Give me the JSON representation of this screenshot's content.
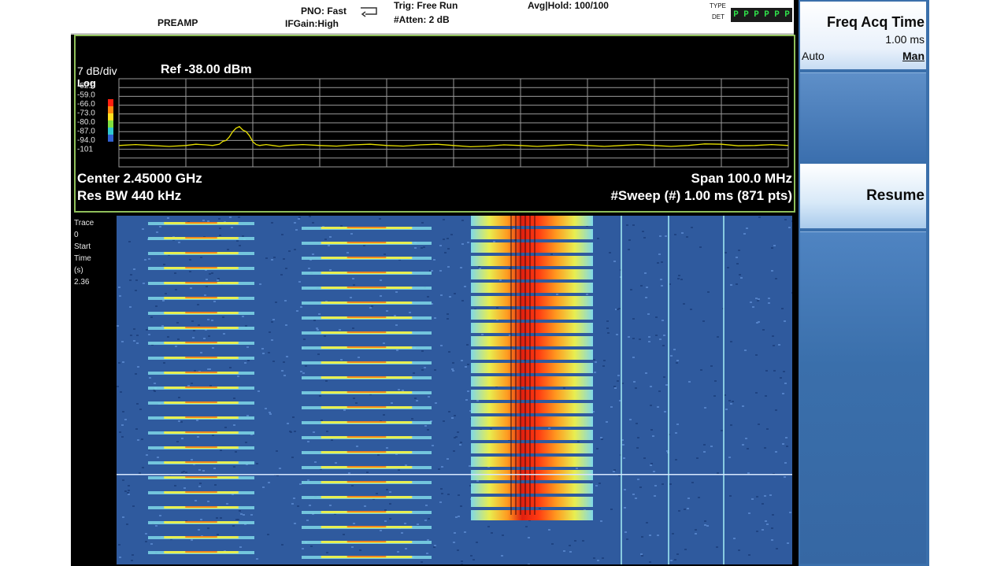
{
  "status": {
    "preamp": "PREAMP",
    "pno": "PNO: Fast",
    "ifgain": "IFGain:High",
    "trig": "Trig: Free Run",
    "atten": "#Atten: 2 dB",
    "avg_hold": "Avg|Hold: 100/100",
    "type_label": "TYPE",
    "det_label": "DET",
    "det_values": [
      "P",
      "P",
      "P",
      "P",
      "P",
      "P"
    ]
  },
  "spectrum": {
    "scale": "7 dB/div",
    "ref": "Ref -38.00 dBm",
    "log": "Log",
    "y_ticks": [
      "-52.0",
      "-59.0",
      "-66.0",
      "-73.0",
      "-80.0",
      "-87.0",
      "-94.0",
      "-101"
    ],
    "center": "Center 2.45000 GHz",
    "span": "Span 100.0 MHz",
    "res_bw": "Res BW 440 kHz",
    "sweep": "#Sweep (#)  1.00 ms (871 pts)",
    "trace_color": "#e8e000",
    "grid_color": "#9a9a9a",
    "border_color": "#8fbf5a"
  },
  "chart_data": {
    "type": "line",
    "title": "",
    "xlabel": "",
    "ylabel": "",
    "x_range_ghz": [
      2.4,
      2.5
    ],
    "ylim": [
      -108,
      -38
    ],
    "x": [
      2.4,
      2.405,
      2.41,
      2.413,
      2.415,
      2.416,
      2.417,
      2.418,
      2.419,
      2.42,
      2.421,
      2.423,
      2.425,
      2.43,
      2.435,
      2.44,
      2.445,
      2.45,
      2.455,
      2.46,
      2.465,
      2.47,
      2.475,
      2.48,
      2.485,
      2.49,
      2.495,
      2.5
    ],
    "series": [
      {
        "values": [
          -91,
          -91,
          -91,
          -90.5,
          -90,
          -87,
          -80,
          -76,
          -80,
          -88,
          -91,
          -91,
          -91,
          -91,
          -90.5,
          -91,
          -90.5,
          -91,
          -91.5,
          -91,
          -91,
          -91,
          -91,
          -91,
          -91,
          -90,
          -91,
          -91
        ]
      }
    ]
  },
  "waterfall": {
    "labels": [
      "Trace",
      "0",
      "Start",
      "Time",
      "(s)",
      "2.36"
    ]
  },
  "softkeys": {
    "title": "Freq Acq Time",
    "value": "1.00 ms",
    "auto": "Auto",
    "man": "Man",
    "resume": "Resume"
  },
  "colors": {
    "softkey_blue": "#3a6fab",
    "waterfall_bg": "#2f5a9e"
  }
}
